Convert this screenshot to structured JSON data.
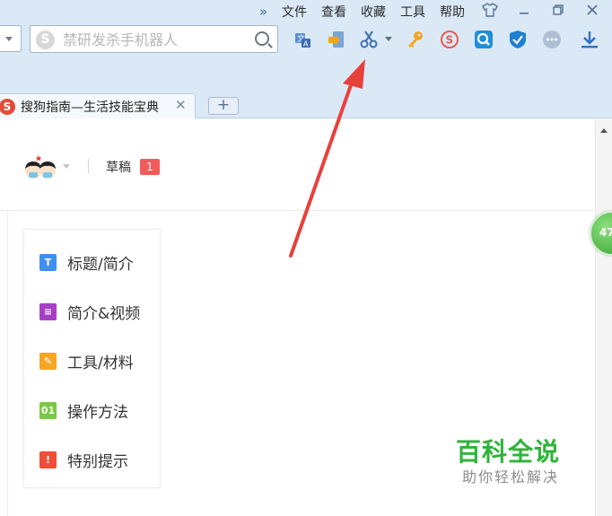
{
  "menubar": {
    "more": "»",
    "items": [
      "文件",
      "查看",
      "收藏",
      "工具",
      "帮助"
    ]
  },
  "search": {
    "placeholder": "禁研发杀手机器人",
    "logo_letter": "S"
  },
  "toolbar": {
    "icons": [
      "translate-icon",
      "sidebar-login-icon",
      "scissors-icon",
      "key-icon",
      "sogou-s-icon",
      "magnifier-app-icon",
      "shield-icon",
      "more-dots-icon",
      "download-icon"
    ]
  },
  "tabs": [
    {
      "label": "搜狗指南—生活技能宝典",
      "favicon": "S"
    }
  ],
  "newtab_label": "+",
  "profile": {
    "draft_label": "草稿",
    "draft_count": "1"
  },
  "menu": {
    "items": [
      {
        "icon_text": "T",
        "label": "标题/简介",
        "color": "#3d8ff0"
      },
      {
        "icon_text": "≡",
        "label": "简介&视频",
        "color": "#a73ec6"
      },
      {
        "icon_text": "✎",
        "label": "工具/材料",
        "color": "#f5a623"
      },
      {
        "icon_text": "01",
        "label": "操作方法",
        "color": "#7ac943"
      },
      {
        "icon_text": "!",
        "label": "特别提示",
        "color": "#f04e37"
      }
    ]
  },
  "floating_ball": "47",
  "watermark": {
    "title": "百科全说",
    "subtitle": "助你轻松解决"
  },
  "colors": {
    "chrome_bg": "#dbe9f7",
    "arrow": "#e8403b",
    "watermark_green": "#2fb33a"
  }
}
